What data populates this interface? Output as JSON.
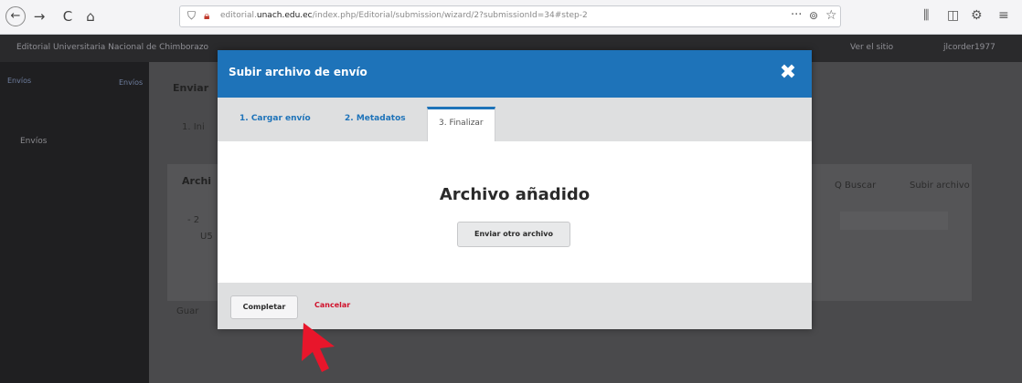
{
  "browser": {
    "url_prefix": "editorial",
    "url_domain": "unach.edu.ec",
    "url_rest": "/index.php/Editorial/submission/wizard/2?submissionId=34#step-2",
    "nav_back": "←",
    "nav_forward": "→",
    "nav_reload": "C",
    "nav_home": "⌂",
    "more_icon": "···",
    "right_icons": [
      "library-icon",
      "sidebar-icon",
      "addon-icon",
      "menu-icon"
    ]
  },
  "app": {
    "site_name": "Editorial Universitaria Nacional de Chimborazo",
    "view_site": "Ver el sitio",
    "user": "jlcorder1977",
    "sidebar_item1": "Envíos",
    "sidebar_item2": "Envíos",
    "sidebar_item3": "Envíos",
    "bg_heading": "Enviar",
    "bg_step": "1. Ini",
    "bg_files": "Archi",
    "bg_search": "Q Buscar",
    "bg_upload": "Subir archivo",
    "bg_save": "Guar",
    "bg_item": "- 2",
    "bg_item2": "U5"
  },
  "modal": {
    "title": "Subir archivo de envío",
    "close_icon": "close-icon",
    "tabs": [
      {
        "label": "1. Cargar envío"
      },
      {
        "label": "2. Metadatos"
      },
      {
        "label": "3. Finalizar"
      }
    ],
    "active_tab": 2,
    "heading": "Archivo añadido",
    "add_another_label": "Enviar otro archivo",
    "complete_label": "Completar",
    "cancel_label": "Cancelar"
  },
  "colors": {
    "accent": "#1e73b9",
    "cancel": "#d0112b",
    "cursor": "#e8162b"
  }
}
